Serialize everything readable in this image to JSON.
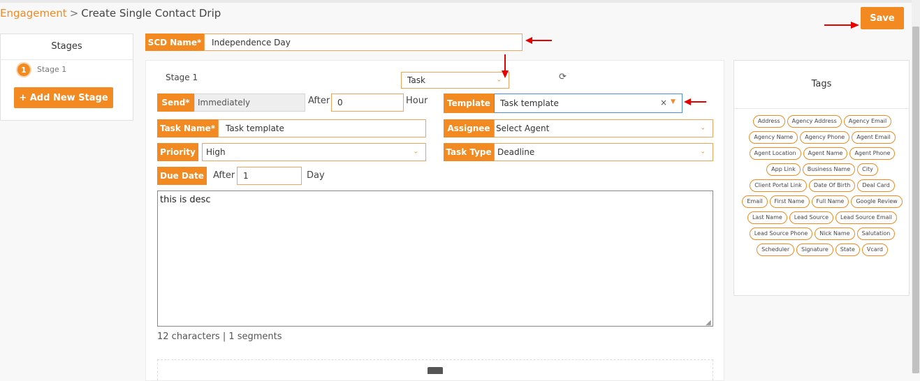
{
  "breadcrumb": {
    "parent": "Engagement",
    "separator": ">",
    "current": "Create Single Contact Drip"
  },
  "save_label": "Save",
  "stages": {
    "title": "Stages",
    "items": [
      {
        "number": "1",
        "label": "Stage 1"
      }
    ],
    "add_label": "+ Add New Stage"
  },
  "scd": {
    "label": "SCD Name*",
    "value": "Independence Day"
  },
  "stage_form": {
    "header": "Stage 1",
    "type_value": "Task",
    "send_label": "Send*",
    "send_value": "Immediately",
    "after_label": "After",
    "after_value": "0",
    "after_unit": "Hour",
    "template_label": "Template",
    "template_value": "Task template",
    "task_name_label": "Task Name*",
    "task_name_value": "Task template",
    "assignee_label": "Assignee",
    "assignee_value": "Select Agent",
    "priority_label": "Priority",
    "priority_value": "High",
    "task_type_label": "Task Type",
    "task_type_value": "Deadline",
    "due_label": "Due Date",
    "due_after_label": "After",
    "due_value": "1",
    "due_unit": "Day",
    "description": "this is desc",
    "char_count": "12 characters | 1 segments"
  },
  "tags": {
    "title": "Tags",
    "items": [
      "Address",
      "Agency Address",
      "Agency Email",
      "Agency Name",
      "Agency Phone",
      "Agent Email",
      "Agent Location",
      "Agent Name",
      "Agent Phone",
      "App Link",
      "Business Name",
      "City",
      "Client Portal Link",
      "Date Of Birth",
      "Deal Card",
      "Email",
      "First Name",
      "Full Name",
      "Google Review",
      "Last Name",
      "Lead Source",
      "Lead Source Email",
      "Lead Source Phone",
      "Nick Name",
      "Salutation",
      "Scheduler",
      "Signature",
      "State",
      "Vcard"
    ]
  },
  "colors": {
    "accent": "#f28a21",
    "arrow": "#e60000"
  },
  "icons": {
    "refresh": "refresh-icon",
    "clear": "close-icon",
    "dropdown": "chevron-down-icon",
    "folder": "folder-icon"
  }
}
